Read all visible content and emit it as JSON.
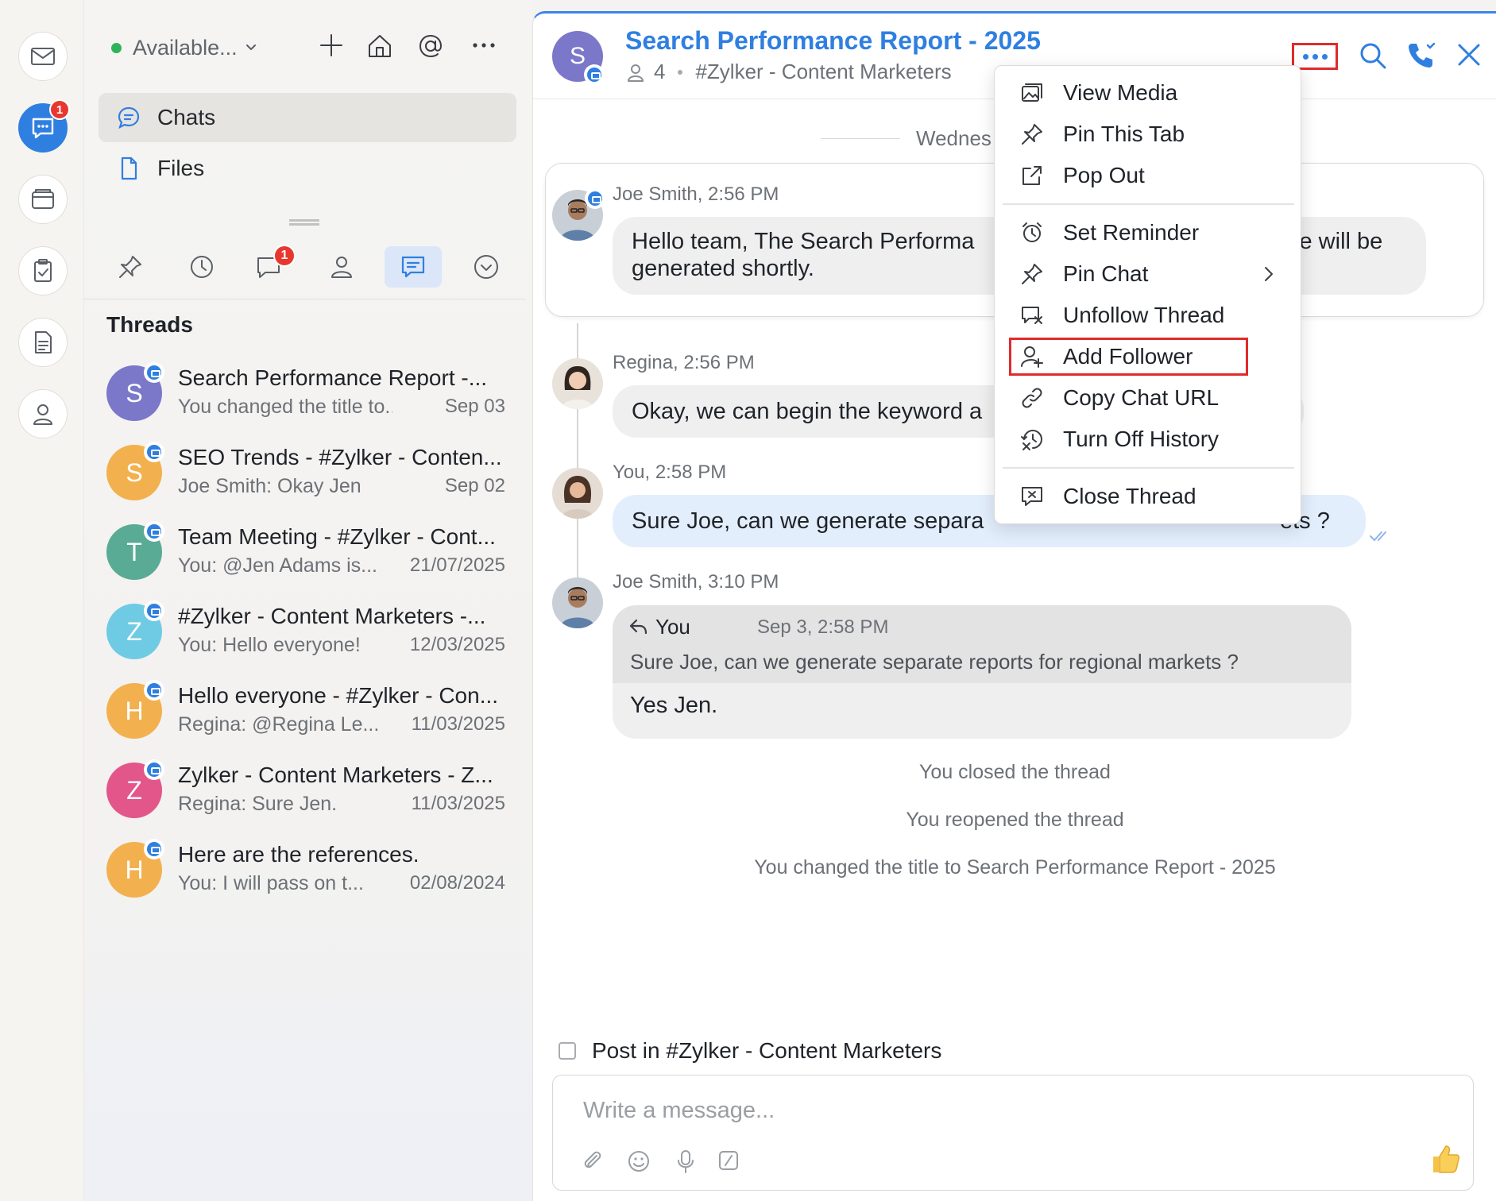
{
  "rail": {
    "items": [
      {
        "icon": "mail-icon"
      },
      {
        "icon": "chat-icon",
        "badge": "1",
        "active": true
      },
      {
        "icon": "wallet-icon"
      },
      {
        "icon": "tasks-icon"
      },
      {
        "icon": "notes-icon"
      },
      {
        "icon": "contacts-icon"
      }
    ]
  },
  "sidebar": {
    "status": "Available...",
    "nav": {
      "chats": "Chats",
      "files": "Files"
    },
    "filters": {
      "chat_badge": "1"
    },
    "threads_heading": "Threads",
    "threads": [
      {
        "avatar": "S",
        "color": "#7b78c9",
        "title": "Search Performance Report -...",
        "preview": "You changed the title to...",
        "date": "Sep 03"
      },
      {
        "avatar": "S",
        "color": "#f2b14e",
        "title": "SEO Trends - #Zylker - Conten...",
        "preview": "Joe Smith: Okay Jen",
        "date": "Sep 02"
      },
      {
        "avatar": "T",
        "color": "#5aab95",
        "title": "Team Meeting - #Zylker - Cont...",
        "preview": "You: @Jen Adams  is...",
        "date": "21/07/2025"
      },
      {
        "avatar": "Z",
        "color": "#6fcbe3",
        "title": "#Zylker - Content Marketers -...",
        "preview": "You: Hello everyone!",
        "date": "12/03/2025"
      },
      {
        "avatar": "H",
        "color": "#f2b14e",
        "title": "Hello everyone - #Zylker - Con...",
        "preview": "Regina: @Regina Le...",
        "date": "11/03/2025"
      },
      {
        "avatar": "Z",
        "color": "#e2568a",
        "title": "Zylker - Content Marketers - Z...",
        "preview": "Regina: Sure Jen.",
        "date": "11/03/2025"
      },
      {
        "avatar": "H",
        "color": "#f2b14e",
        "title": "Here are the references.",
        "preview": "You: I will pass on t...",
        "date": "02/08/2024"
      }
    ]
  },
  "chat": {
    "avatar": "S",
    "title": "Search Performance Report - 2025",
    "member_count": "4",
    "channel": "#Zylker - Content Marketers",
    "date_separator": "Wednes",
    "messages": [
      {
        "author": "Joe Smith, 2:56 PM",
        "text": "Hello team, The Search Performa",
        "text_tail": "ite will be",
        "text_line2": "generated shortly."
      },
      {
        "author": "Regina, 2:56 PM",
        "text": "Okay, we can begin the keyword a"
      },
      {
        "author": "You, 2:58 PM",
        "text": "Sure Joe, can we generate separa",
        "text_tail": "ets ?"
      },
      {
        "author": "Joe Smith, 3:10 PM"
      }
    ],
    "quote": {
      "author": "You",
      "time": "Sep 3, 2:58 PM",
      "text": "Sure Joe, can we generate separate reports for regional markets ?"
    },
    "reply": "Yes Jen.",
    "system": [
      "You closed the thread",
      "You reopened the thread",
      "You changed the title to Search Performance Report - 2025"
    ],
    "post_in_label": "Post in #Zylker - Content Marketers",
    "composer_placeholder": "Write a message..."
  },
  "menu": {
    "items": [
      {
        "label": "View Media",
        "icon": "media-icon"
      },
      {
        "label": "Pin This Tab",
        "icon": "pin-icon"
      },
      {
        "label": "Pop Out",
        "icon": "pop-out-icon"
      },
      {
        "label": "Set Reminder",
        "icon": "alarm-icon"
      },
      {
        "label": "Pin Chat",
        "icon": "pin-icon",
        "submenu": true
      },
      {
        "label": "Unfollow Thread",
        "icon": "unfollow-icon"
      },
      {
        "label": "Add Follower",
        "icon": "add-user-icon",
        "highlighted": true
      },
      {
        "label": "Copy Chat URL",
        "icon": "link-icon"
      },
      {
        "label": "Turn Off History",
        "icon": "history-off-icon"
      },
      {
        "label": "Close Thread",
        "icon": "close-thread-icon"
      }
    ]
  },
  "colors": {
    "accent": "#2f7fe0",
    "badge": "#e8372e",
    "highlight": "#e02b2b"
  }
}
